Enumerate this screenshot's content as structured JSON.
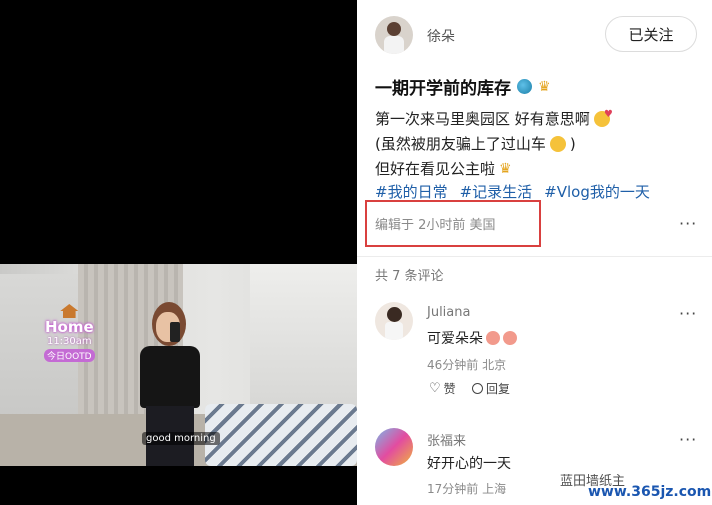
{
  "post": {
    "author": "徐朵",
    "follow_label": "已关注",
    "title": "一期开学前的库存",
    "lines": [
      "第一次来马里奥园区 好有意思啊",
      "(虽然被朋友骗上了过山车",
      ")",
      "但好在看见公主啦"
    ],
    "tags": [
      "#我的日常",
      "#记录生活",
      "#Vlog我的一天"
    ],
    "meta": "编辑于 2小时前 美国",
    "more_label": "···"
  },
  "photo_overlay": {
    "home_label": "Home",
    "time_label": "11:30am",
    "date_label": "今日OOTD",
    "caption": "good morning"
  },
  "comments": {
    "count_label": "共 7 条评论",
    "items": [
      {
        "name": "Juliana",
        "text": "可爱朵朵",
        "time": "46分钟前 北京",
        "like_label": "赞",
        "reply_label": "回复"
      },
      {
        "name": "张福来",
        "text": "好开心的一天",
        "time": "17分钟前 上海"
      }
    ]
  },
  "watermark": {
    "text": "蓝田墙纸主",
    "url": "www.365jz.com"
  },
  "icons": {
    "globe": "globe-icon",
    "crown": "crown-icon",
    "kiss": "kiss-emoji-icon",
    "grin": "grin-emoji-icon",
    "peach": "peach-emoji-icon"
  }
}
